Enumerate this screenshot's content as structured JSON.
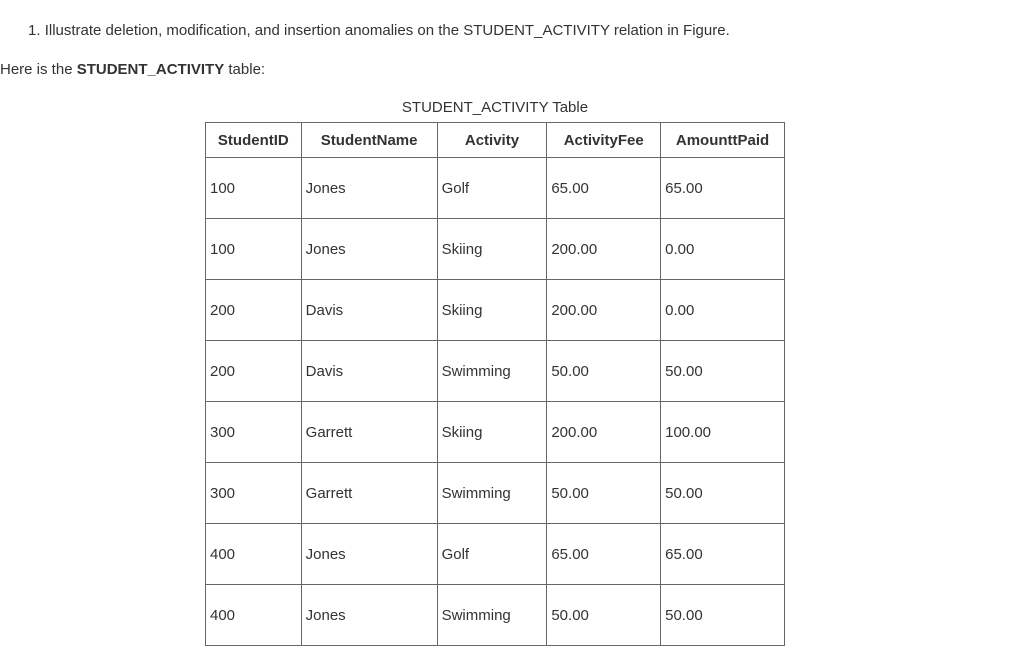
{
  "question_number": "1.",
  "question_text": "Illustrate deletion, modification, and insertion anomalies on the STUDENT_ACTIVITY relation in Figure.",
  "intro_prefix": "Here is the ",
  "intro_bold": "STUDENT_ACTIVITY",
  "intro_suffix": " table:",
  "table_title": "STUDENT_ACTIVITY Table",
  "columns": [
    "StudentID",
    "StudentName",
    "Activity",
    "ActivityFee",
    "AmounttPaid"
  ],
  "rows": [
    {
      "id": "100",
      "name": "Jones",
      "act": "Golf",
      "fee": "65.00",
      "paid": "65.00"
    },
    {
      "id": "100",
      "name": "Jones",
      "act": "Skiing",
      "fee": "200.00",
      "paid": "0.00"
    },
    {
      "id": "200",
      "name": "Davis",
      "act": "Skiing",
      "fee": "200.00",
      "paid": "0.00"
    },
    {
      "id": "200",
      "name": "Davis",
      "act": "Swimming",
      "fee": "50.00",
      "paid": "50.00"
    },
    {
      "id": "300",
      "name": "Garrett",
      "act": "Skiing",
      "fee": "200.00",
      "paid": "100.00"
    },
    {
      "id": "300",
      "name": "Garrett",
      "act": "Swimming",
      "fee": "50.00",
      "paid": "50.00"
    },
    {
      "id": "400",
      "name": "Jones",
      "act": "Golf",
      "fee": "65.00",
      "paid": "65.00"
    },
    {
      "id": "400",
      "name": "Jones",
      "act": "Swimming",
      "fee": "50.00",
      "paid": "50.00"
    }
  ]
}
